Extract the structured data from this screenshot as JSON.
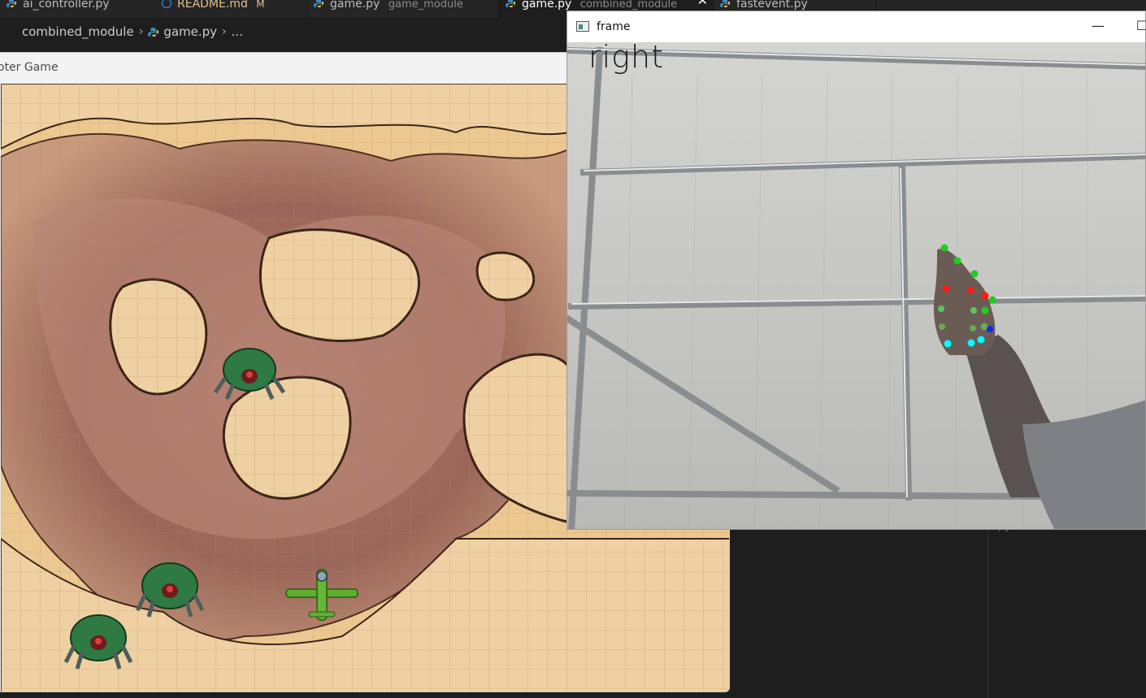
{
  "tabs": [
    {
      "label": "ai_controller.py",
      "desc": "",
      "badge": "",
      "icon": "python-icon",
      "active": false
    },
    {
      "label": "README.md",
      "desc": "",
      "badge": "M",
      "icon": "info-icon",
      "active": false
    },
    {
      "label": "game.py",
      "desc": "game_module",
      "badge": "",
      "icon": "python-icon",
      "active": false
    },
    {
      "label": "game.py",
      "desc": "combined_module",
      "badge": "",
      "icon": "python-icon",
      "active": true
    },
    {
      "label": "fastevent.py",
      "desc": "",
      "badge": "",
      "icon": "python-icon",
      "active": false
    }
  ],
  "breadcrumb": {
    "folder": "combined_module",
    "file": "game.py",
    "rest": "..."
  },
  "game_window": {
    "title": "oter Game"
  },
  "frame_window": {
    "title": "frame",
    "minimize": "—",
    "maximize": "☐",
    "gesture_text": "right"
  },
  "right_panel": {
    "text": "py"
  },
  "colors": {
    "python_icon": "#3c8dbc",
    "modified": "#e2c08d",
    "landmark_green": "#22cc22",
    "landmark_red": "#ff1a1a",
    "landmark_cyan": "#00ffff",
    "landmark_blue": "#0a2aff"
  }
}
